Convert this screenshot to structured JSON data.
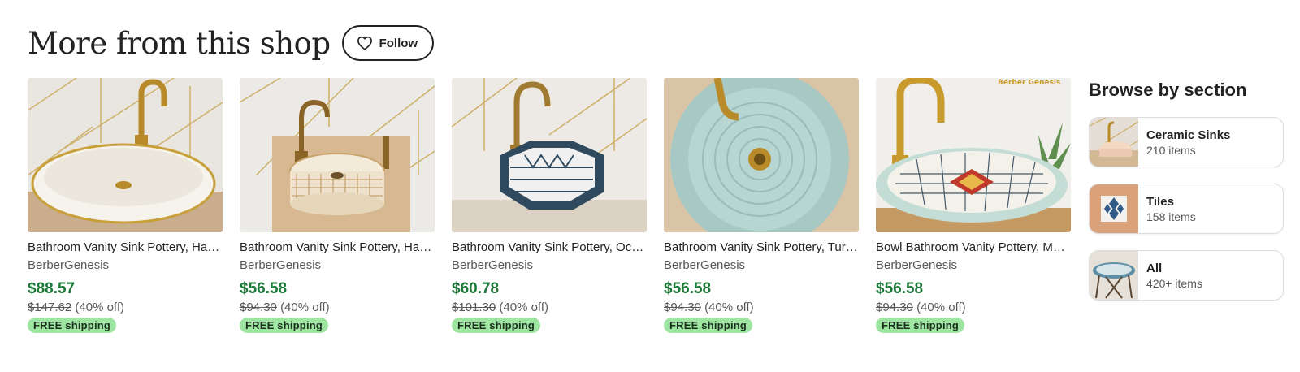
{
  "header": {
    "title": "More from this shop",
    "follow_label": "Follow"
  },
  "listings": [
    {
      "title": "Bathroom Vanity Sink Pottery, Handmade Oval Sink",
      "shop": "BerberGenesis",
      "price": "$88.57",
      "original_price": "$147.62",
      "discount": "(40% off)",
      "shipping": "FREE shipping"
    },
    {
      "title": "Bathroom Vanity Sink Pottery, Handmade Round Sink",
      "shop": "BerberGenesis",
      "price": "$56.58",
      "original_price": "$94.30",
      "discount": "(40% off)",
      "shipping": "FREE shipping"
    },
    {
      "title": "Bathroom Vanity Sink Pottery, Octagonal Sink",
      "shop": "BerberGenesis",
      "price": "$60.78",
      "original_price": "$101.30",
      "discount": "(40% off)",
      "shipping": "FREE shipping"
    },
    {
      "title": "Bathroom Vanity Sink Pottery, Turquoise Sink",
      "shop": "BerberGenesis",
      "price": "$56.58",
      "original_price": "$94.30",
      "discount": "(40% off)",
      "shipping": "FREE shipping"
    },
    {
      "title": "Bowl Bathroom Vanity Pottery, Moroccan Sink",
      "shop": "BerberGenesis",
      "price": "$56.58",
      "original_price": "$94.30",
      "discount": "(40% off)",
      "shipping": "FREE shipping",
      "image_watermark": "Berber Genesis"
    }
  ],
  "browse": {
    "title": "Browse by section",
    "sections": [
      {
        "name": "Ceramic Sinks",
        "count": "210 items"
      },
      {
        "name": "Tiles",
        "count": "158 items"
      },
      {
        "name": "All",
        "count": "420+ items"
      }
    ]
  },
  "colors": {
    "price_green": "#1e7a3a",
    "shipping_badge": "#9ee5a2",
    "text": "#222222",
    "muted_text": "#595959"
  },
  "icons": {
    "follow": "heart-outline-icon"
  }
}
